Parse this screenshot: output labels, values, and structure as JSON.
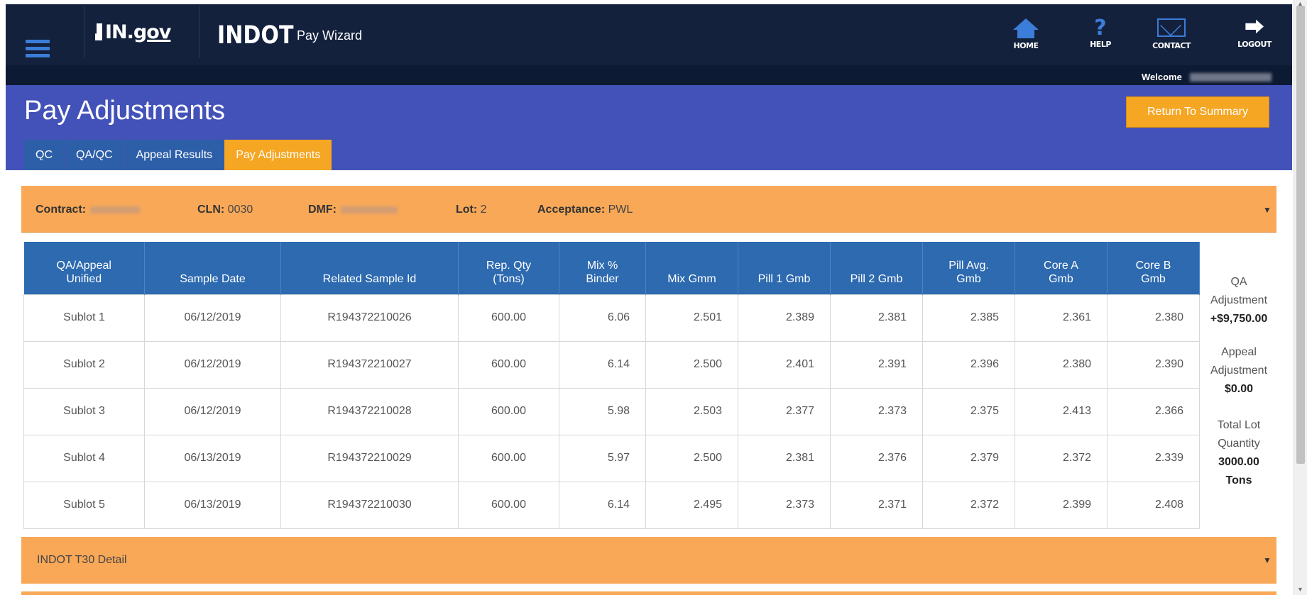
{
  "nav": {
    "ingov_prefix": "IN.",
    "ingov_suffix": "gov",
    "brand": "INDOT",
    "app_name": "Pay Wizard",
    "home": "HOME",
    "help": "HELP",
    "contact": "CONTACT",
    "logout": "LOGOUT",
    "welcome": "Welcome"
  },
  "header": {
    "title": "Pay Adjustments",
    "return_button": "Return To Summary",
    "tabs": [
      "QC",
      "QA/QC",
      "Appeal Results",
      "Pay Adjustments"
    ],
    "active_tab": "Pay Adjustments"
  },
  "contract": {
    "contract_label": "Contract:",
    "cln_label": "CLN:",
    "cln_value": "0030",
    "dmf_label": "DMF:",
    "lot_label": "Lot:",
    "lot_value": "2",
    "acceptance_label": "Acceptance:",
    "acceptance_value": "PWL"
  },
  "table": {
    "headers": [
      [
        "QA/Appeal",
        "Unified"
      ],
      [
        "Sample Date"
      ],
      [
        "Related Sample Id"
      ],
      [
        "Rep. Qty",
        "(Tons)"
      ],
      [
        "Mix %",
        "Binder"
      ],
      [
        "Mix Gmm"
      ],
      [
        "Pill 1 Gmb"
      ],
      [
        "Pill 2 Gmb"
      ],
      [
        "Pill Avg.",
        "Gmb"
      ],
      [
        "Core A",
        "Gmb"
      ],
      [
        "Core B",
        "Gmb"
      ]
    ],
    "rows": [
      [
        "Sublot 1",
        "06/12/2019",
        "R194372210026",
        "600.00",
        "6.06",
        "2.501",
        "2.389",
        "2.381",
        "2.385",
        "2.361",
        "2.380"
      ],
      [
        "Sublot 2",
        "06/12/2019",
        "R194372210027",
        "600.00",
        "6.14",
        "2.500",
        "2.401",
        "2.391",
        "2.396",
        "2.380",
        "2.390"
      ],
      [
        "Sublot 3",
        "06/12/2019",
        "R194372210028",
        "600.00",
        "5.98",
        "2.503",
        "2.377",
        "2.373",
        "2.375",
        "2.413",
        "2.366"
      ],
      [
        "Sublot 4",
        "06/13/2019",
        "R194372210029",
        "600.00",
        "5.97",
        "2.500",
        "2.381",
        "2.376",
        "2.379",
        "2.372",
        "2.339"
      ],
      [
        "Sublot 5",
        "06/13/2019",
        "R194372210030",
        "600.00",
        "6.14",
        "2.495",
        "2.373",
        "2.371",
        "2.372",
        "2.399",
        "2.408"
      ]
    ]
  },
  "summary": {
    "qa_label_1": "QA",
    "qa_label_2": "Adjustment",
    "qa_value": "+$9,750.00",
    "appeal_label_1": "Appeal",
    "appeal_label_2": "Adjustment",
    "appeal_value": "$0.00",
    "total_label_1": "Total Lot",
    "total_label_2": "Quantity",
    "total_value_1": "3000.00",
    "total_value_2": "Tons"
  },
  "t30": {
    "label": "INDOT T30 Detail"
  },
  "colors": {
    "navbar": "#14213d",
    "header": "#4352b8",
    "accent_orange": "#f5a623",
    "table_header": "#2d6ab0",
    "icon_blue": "#3b7dd8"
  }
}
